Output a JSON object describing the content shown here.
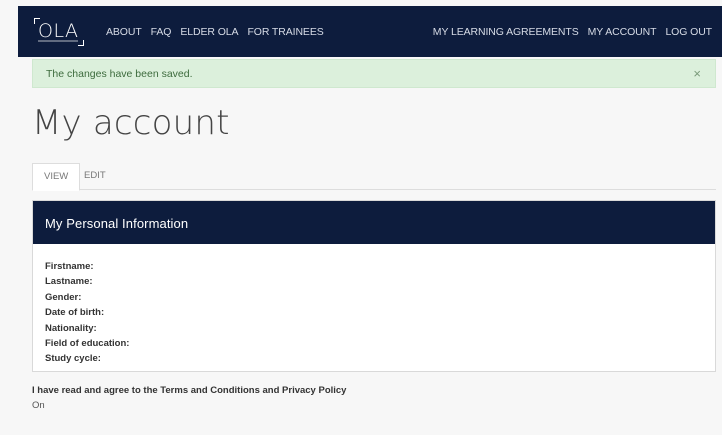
{
  "brand": {
    "logo_text": "OLA"
  },
  "nav": {
    "left": [
      "ABOUT",
      "FAQ",
      "ELDER OLA",
      "FOR TRAINEES"
    ],
    "right": [
      "MY LEARNING AGREEMENTS",
      "MY ACCOUNT",
      "LOG OUT"
    ]
  },
  "alert": {
    "message": "The changes have been saved.",
    "close": "×"
  },
  "page": {
    "title": "My account"
  },
  "tabs": [
    {
      "label": "VIEW",
      "active": true
    },
    {
      "label": "EDIT",
      "active": false
    }
  ],
  "personal_info": {
    "title": "My Personal Information",
    "fields": [
      "Firstname:",
      "Lastname:",
      "Gender:",
      "Date of birth:",
      "Nationality:",
      "Field of education:",
      "Study cycle:"
    ]
  },
  "terms": {
    "label": "I have read and agree to the Terms and Conditions and Privacy Policy",
    "value": "On"
  },
  "colors": {
    "navbar": "#0d1c3d",
    "alert_bg": "#dcf0dc",
    "alert_text": "#3d6b3d",
    "page_bg": "#f7f7f7"
  }
}
